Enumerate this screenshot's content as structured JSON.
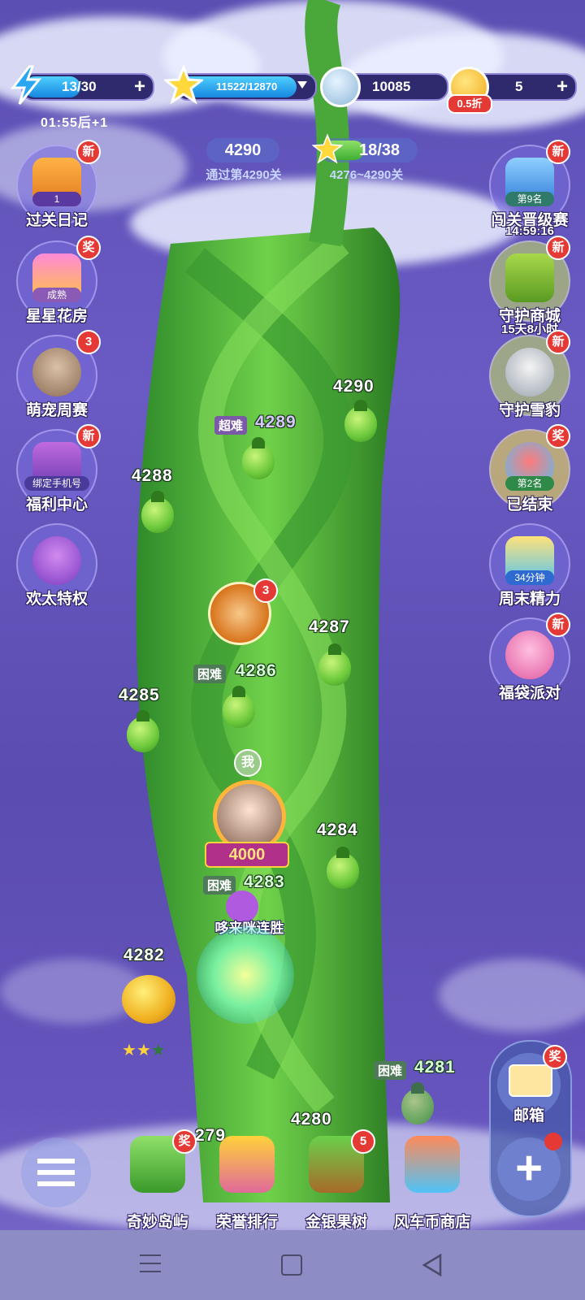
{
  "top_bar": {
    "energy": {
      "value": "13/30",
      "fill": 0.433,
      "timer": "01:55后+1"
    },
    "stars": {
      "value": "11522/12870",
      "fill": 0.895
    },
    "coins": {
      "value": "10085"
    },
    "tokens": {
      "value": "5",
      "discount": "0.5折"
    }
  },
  "level_info": {
    "current_level": "4290",
    "current_caption": "通过第4290关",
    "star_progress": "18/38",
    "star_range": "4276~4290关"
  },
  "left_menu": [
    {
      "label": "过关日记",
      "badge": "新",
      "tag": "1"
    },
    {
      "label": "星星花房",
      "badge": "奖",
      "tag": "成熟"
    },
    {
      "label": "萌宠周赛",
      "badge": "3"
    },
    {
      "label": "福利中心",
      "badge": "新",
      "tag": "绑定手机号"
    },
    {
      "label": "欢太特权"
    }
  ],
  "right_menu": [
    {
      "label": "闯关晋级赛",
      "badge": "新",
      "tag": "第9名",
      "sub": "14:59:16"
    },
    {
      "label": "守护商城",
      "badge": "新",
      "sub": "15天8小时"
    },
    {
      "label": "守护雪豹",
      "badge": "新"
    },
    {
      "label": "已结束",
      "badge": "奖",
      "tag": "第2名"
    },
    {
      "label": "周末精力",
      "tag": "34分钟"
    },
    {
      "label": "福袋派对",
      "badge": "新"
    }
  ],
  "levels": [
    {
      "number": "4290"
    },
    {
      "number": "4289",
      "difficulty": "超难"
    },
    {
      "number": "4288"
    },
    {
      "number": "4287"
    },
    {
      "number": "4286",
      "difficulty": "困难"
    },
    {
      "number": "4285"
    },
    {
      "number": "4284"
    },
    {
      "number": "4283",
      "difficulty": "困难"
    },
    {
      "number": "4282",
      "stars": 2
    },
    {
      "number": "4281",
      "difficulty": "困难"
    },
    {
      "number": "4280"
    },
    {
      "number": "279"
    }
  ],
  "chest_badge": "3",
  "player": {
    "me_label": "我",
    "score": "4000",
    "event_label": "哆来咪连胜"
  },
  "bottom_nav": [
    {
      "label": "奇妙岛屿",
      "badge": "奖"
    },
    {
      "label": "荣誉排行"
    },
    {
      "label": "金银果树",
      "badge": "5"
    },
    {
      "label": "风车币商店"
    }
  ],
  "mailbox": {
    "label": "邮箱",
    "badge": "奖"
  },
  "system_nav": [
    "menu",
    "home",
    "back"
  ]
}
